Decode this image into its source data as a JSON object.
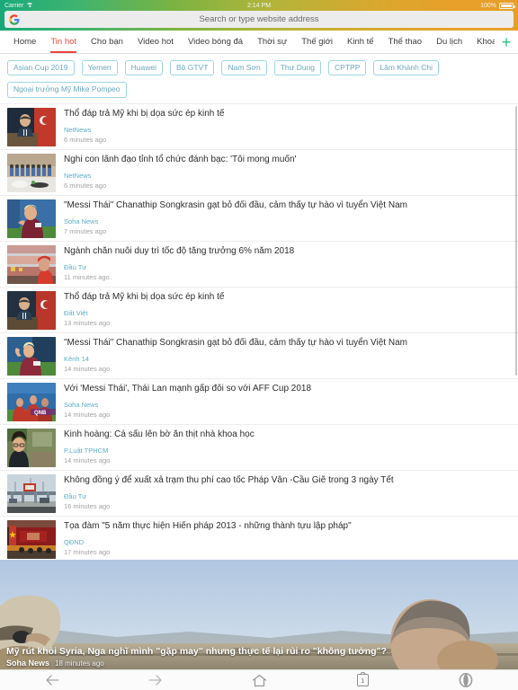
{
  "status_bar": {
    "carrier": "Carrier",
    "wifi_icon": "wifi-icon",
    "time": "2:14 PM",
    "battery_percent": "100%",
    "battery_icon": "battery-full-icon"
  },
  "url_bar": {
    "logo_icon": "google-logo-icon",
    "placeholder": "Search or type website address",
    "value": ""
  },
  "nav_tabs": {
    "items": [
      {
        "label": "Home",
        "active": false
      },
      {
        "label": "Tin hot",
        "active": true
      },
      {
        "label": "Cho bạn",
        "active": false
      },
      {
        "label": "Video hot",
        "active": false
      },
      {
        "label": "Video bóng đá",
        "active": false
      },
      {
        "label": "Thời sự",
        "active": false
      },
      {
        "label": "Thế giới",
        "active": false
      },
      {
        "label": "Kinh tế",
        "active": false
      },
      {
        "label": "Thể thao",
        "active": false
      },
      {
        "label": "Du lịch",
        "active": false
      },
      {
        "label": "Khoa học",
        "active": false
      }
    ],
    "add_label": "+",
    "add_icon": "plus-icon",
    "active_color": "#e8483c",
    "add_color": "#23c07e"
  },
  "chips": {
    "border_color": "#9fd4e4",
    "text_color": "#6aa9bd",
    "items": [
      "Asian Cup 2019",
      "Yemen",
      "Huawei",
      "Bộ GTVT",
      "Nam Sơn",
      "Thư Dung",
      "CPTPP",
      "Lâm Khánh Chi",
      "Ngoại trưởng Mỹ Mike Pompeo"
    ]
  },
  "news": {
    "items": [
      {
        "title": "Thổ đáp trả Mỹ khi bị dọa sức ép kinh tế",
        "source": "NetNews",
        "time": "6 minutes ago",
        "thumb": "politician-podium-turkish-flag"
      },
      {
        "title": "Nghi con lãnh đạo tỉnh tổ chức đánh bạc: 'Tôi mong muốn'",
        "source": "NetNews",
        "time": "6 minutes ago",
        "thumb": "group-people-seated-outdoors"
      },
      {
        "title": "\"Messi Thái\" Chanathip Songkrasin gạt bỏ đối đầu, cảm thấy tự hào vì tuyển Việt Nam",
        "source": "Soha News",
        "time": "7 minutes ago",
        "thumb": "footballer-blond-maroon-jersey"
      },
      {
        "title": "Ngành chăn nuôi duy trì tốc độ tăng trưởng 6% năm 2018",
        "source": "Đầu Tư",
        "time": "11 minutes ago",
        "thumb": "supermarket-meat-counter-worker"
      },
      {
        "title": "Thổ đáp trả Mỹ khi bị dọa sức ép kinh tế",
        "source": "Đất Việt",
        "time": "13 minutes ago",
        "thumb": "politician-podium-turkish-flag"
      },
      {
        "title": "\"Messi Thái\" Chanathip Songkrasin gạt bỏ đối đầu, cảm thấy tự hào vì tuyển Việt Nam",
        "source": "Kênh 14",
        "time": "14 minutes ago",
        "thumb": "footballer-raising-arm-stadium"
      },
      {
        "title": "Với 'Messi Thái', Thái Lan mạnh gấp đôi so với AFF Cup 2018",
        "source": "Soha News",
        "time": "14 minutes ago",
        "thumb": "football-team-celebration-qnb"
      },
      {
        "title": "Kinh hoàng: Cá sấu lên bờ ăn thịt nhà khoa học",
        "source": "P.Luật TPHCM",
        "time": "14 minutes ago",
        "thumb": "woman-portrait-glasses-outdoors"
      },
      {
        "title": "Không đồng ý để xuất xả trạm thu phí cao tốc Pháp Vân -Cầu Giẽ trong 3 ngày Tết",
        "source": "Đầu Tư",
        "time": "16 minutes ago",
        "thumb": "highway-toll-station"
      },
      {
        "title": "Tọa đàm \"5 năm thực hiện Hiến pháp 2013 - những thành tựu lập pháp\"",
        "source": "QĐND",
        "time": "17 minutes ago",
        "thumb": "conference-hall-red-banner"
      }
    ]
  },
  "featured": {
    "title": "Mỹ rút khỏi Syria, Nga nghĩ mình \"gặp may\" nhưng thực tế lại rủi ro \"không tưởng\"?",
    "source": "Soha News",
    "time": "18 minutes ago",
    "image": "two-soldiers-looking-over-valley-sky"
  },
  "toolbar": {
    "back_icon": "arrow-left-icon",
    "forward_icon": "arrow-right-icon",
    "home_icon": "home-icon",
    "tabs_icon": "tab-count-icon",
    "tabs_count": "1",
    "menu_icon": "opera-menu-icon"
  }
}
